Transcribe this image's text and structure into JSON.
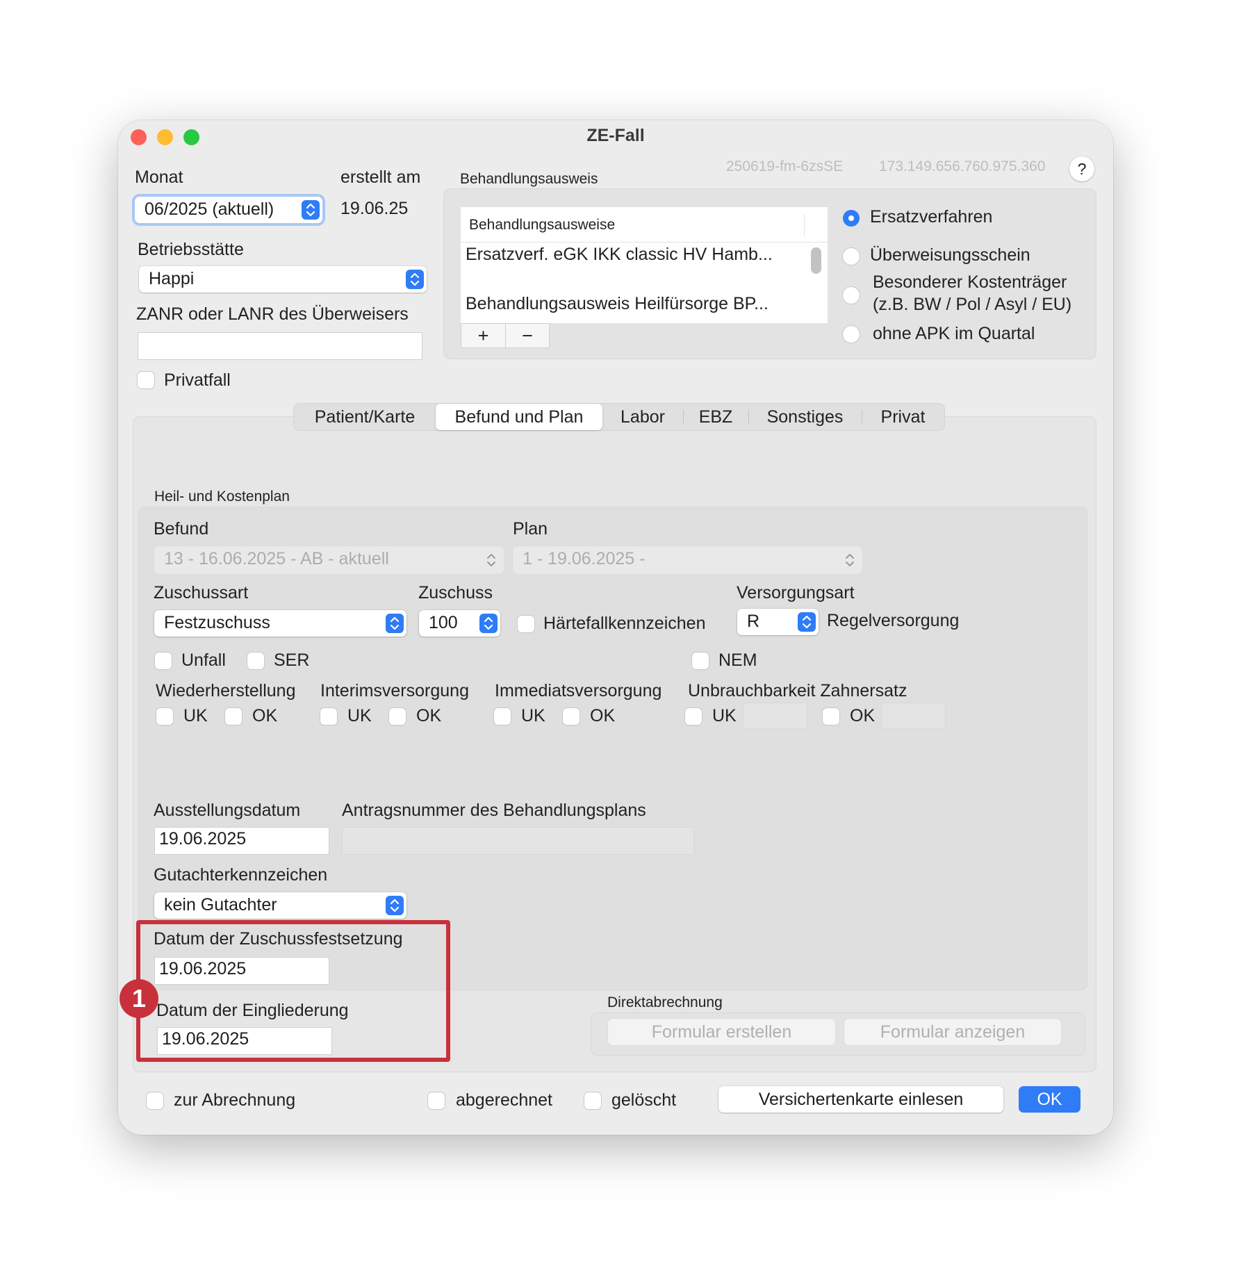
{
  "window": {
    "title": "ZE-Fall",
    "build_id": "250619-fm-6zsSE",
    "version": "173.149.656.760.975.360",
    "help_label": "?"
  },
  "header": {
    "monat_label": "Monat",
    "monat_value": "06/2025 (aktuell)",
    "erstellt_label": "erstellt am",
    "erstellt_value": "19.06.25",
    "betriebsstaette_label": "Betriebsstätte",
    "betriebsstaette_value": "Happi",
    "zanr_label": "ZANR oder LANR des Überweisers",
    "zanr_value": "",
    "privatfall_label": "Privatfall"
  },
  "behandlungsausweis": {
    "group_label": "Behandlungsausweis",
    "list_header": "Behandlungsausweise",
    "items": [
      "Ersatzverf. eGK IKK classic HV Hamb...",
      "Behandlungsausweis Heilfürsorge BP..."
    ],
    "add_label": "+",
    "remove_label": "−",
    "radios": [
      {
        "label": "Ersatzverfahren",
        "selected": true
      },
      {
        "label": "Überweisungsschein",
        "selected": false
      },
      {
        "label": "Besonderer Kostenträger",
        "label2": "(z.B. BW / Pol / Asyl / EU)",
        "selected": false
      },
      {
        "label": "ohne APK im Quartal",
        "selected": false
      }
    ]
  },
  "tabs": [
    {
      "label": "Patient/Karte",
      "active": false
    },
    {
      "label": "Befund und Plan",
      "active": true
    },
    {
      "label": "Labor",
      "active": false
    },
    {
      "label": "EBZ",
      "active": false
    },
    {
      "label": "Sonstiges",
      "active": false
    },
    {
      "label": "Privat",
      "active": false
    }
  ],
  "hkp": {
    "group_label": "Heil- und Kostenplan",
    "befund_label": "Befund",
    "befund_value": "13 - 16.06.2025 - AB - aktuell",
    "plan_label": "Plan",
    "plan_value": "1 - 19.06.2025 -",
    "zuschussart_label": "Zuschussart",
    "zuschussart_value": "Festzuschuss",
    "zuschuss_label": "Zuschuss",
    "zuschuss_value": "100",
    "haertefall_label": "Härtefallkennzeichen",
    "versorgungsart_label": "Versorgungsart",
    "versorgungsart_value": "R",
    "versorgungsart_desc": "Regelversorgung",
    "unfall_label": "Unfall",
    "ser_label": "SER",
    "nem_label": "NEM",
    "wiederherstellung_label": "Wiederherstellung",
    "interims_label": "Interimsversorgung",
    "immediats_label": "Immediatsversorgung",
    "unbrauchbarkeit_label": "Unbrauchbarkeit Zahnersatz",
    "uk_label": "UK",
    "ok_label": "OK",
    "ausstellungsdatum_label": "Ausstellungsdatum",
    "ausstellungsdatum_value": "19.06.2025",
    "antragsnummer_label": "Antragsnummer des Behandlungsplans",
    "antragsnummer_value": "",
    "gutachter_label": "Gutachterkennzeichen",
    "gutachter_value": "kein Gutachter",
    "zuschussfestsetzung_label": "Datum der Zuschussfestsetzung",
    "zuschussfestsetzung_value": "19.06.2025",
    "eingliederung_label": "Datum der Eingliederung",
    "eingliederung_value": "19.06.2025"
  },
  "direktabrechnung": {
    "group_label": "Direktabrechnung",
    "create_label": "Formular erstellen",
    "show_label": "Formular anzeigen"
  },
  "footer": {
    "zur_abrechnung_label": "zur Abrechnung",
    "abgerechnet_label": "abgerechnet",
    "geloescht_label": "gelöscht",
    "karte_button": "Versichertenkarte einlesen",
    "ok_button": "OK"
  },
  "annotation": {
    "badge": "1",
    "color": "#c8303c"
  },
  "colors": {
    "accent": "#2f7cf6",
    "close": "#fe5f57",
    "minimize": "#febc2e",
    "zoom": "#28c840"
  }
}
